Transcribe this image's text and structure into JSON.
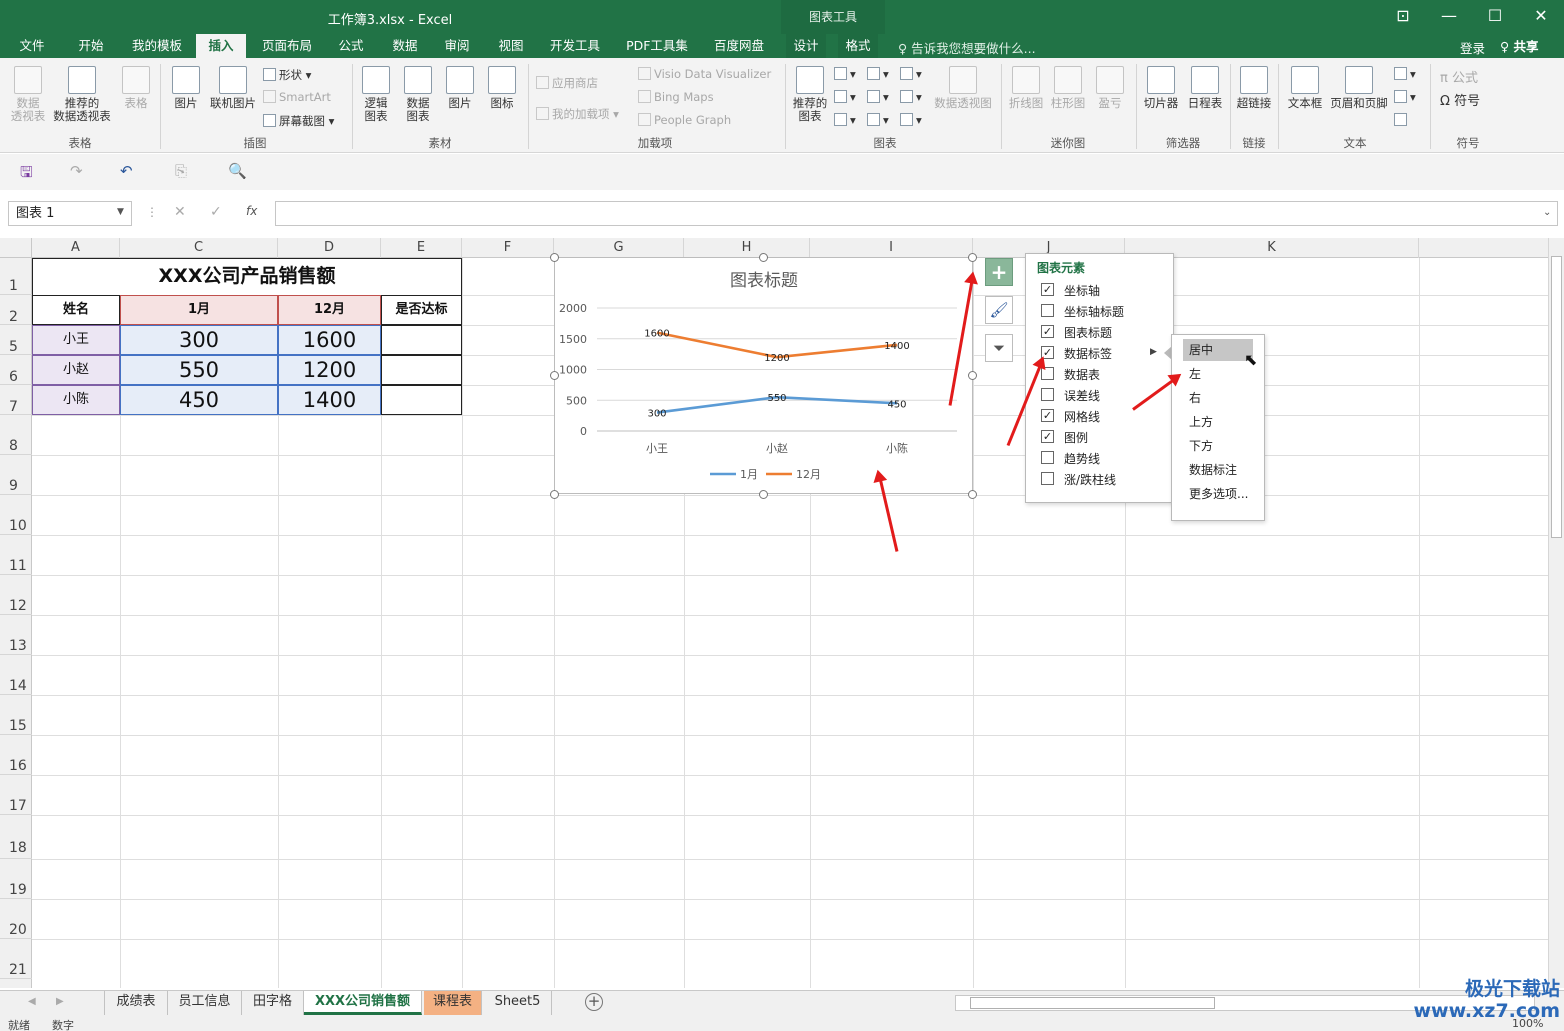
{
  "window": {
    "title": "工作簿3.xlsx - Excel",
    "context_group": "图表工具",
    "buttons": {
      "restore": "⊡",
      "minimize": "—",
      "maximize": "☐",
      "close": "✕"
    }
  },
  "tabs": [
    "文件",
    "开始",
    "我的模板",
    "插入",
    "页面布局",
    "公式",
    "数据",
    "审阅",
    "视图",
    "开发工具",
    "PDF工具集",
    "百度网盘",
    "设计",
    "格式"
  ],
  "active_tab": "插入",
  "tell_me": "♀ 告诉我您想要做什么...",
  "login": "登录",
  "share": "♀ 共享",
  "ribbon": {
    "table_group": {
      "label": "表格",
      "pivot": "数据\n透视表",
      "recommended_pivot": "推荐的\n数据透视表",
      "table": "表格"
    },
    "illustrations": {
      "label": "插图",
      "picture": "图片",
      "online_picture": "联机图片",
      "shapes": "形状",
      "smartart": "SmartArt",
      "screenshot": "屏幕截图"
    },
    "material": {
      "label": "素材",
      "logic_chart": "逻辑\n图表",
      "data_chart": "数据\n图表",
      "picture": "图片",
      "icon": "图标"
    },
    "addins": {
      "label": "加载项",
      "store": "应用商店",
      "my_addins": "我的加载项",
      "visio": "Visio Data Visualizer",
      "bing": "Bing Maps",
      "people": "People Graph"
    },
    "charts": {
      "label": "图表",
      "recommended": "推荐的\n图表",
      "pivot_chart": "数据透视图"
    },
    "sparklines": {
      "label": "迷你图",
      "line": "折线图",
      "column": "柱形图",
      "winloss": "盈亏"
    },
    "filters": {
      "label": "筛选器",
      "slicer": "切片器",
      "timeline": "日程表"
    },
    "links": {
      "label": "链接",
      "hyperlink": "超链接"
    },
    "text": {
      "label": "文本",
      "textbox": "文本框",
      "header_footer": "页眉和页脚"
    },
    "symbols": {
      "label": "符号",
      "equation": "π 公式",
      "symbol": "Ω 符号"
    }
  },
  "name_box": "图表 1",
  "fx": "fx",
  "columns": [
    "A",
    "C",
    "D",
    "E",
    "F",
    "G",
    "H",
    "I",
    "J",
    "K"
  ],
  "rows": [
    "1",
    "2",
    "5",
    "6",
    "7",
    "8",
    "9",
    "10",
    "11",
    "12",
    "13",
    "14",
    "15",
    "16",
    "17",
    "18",
    "19",
    "20",
    "21"
  ],
  "table": {
    "title": "XXX公司产品销售额",
    "headers": [
      "姓名",
      "1月",
      "12月",
      "是否达标"
    ],
    "rows": [
      [
        "小王",
        "300",
        "1600",
        ""
      ],
      [
        "小赵",
        "550",
        "1200",
        ""
      ],
      [
        "小陈",
        "450",
        "1400",
        ""
      ]
    ]
  },
  "chart_data": {
    "type": "line",
    "title": "图表标题",
    "categories": [
      "小王",
      "小赵",
      "小陈"
    ],
    "series": [
      {
        "name": "1月",
        "values": [
          300,
          550,
          450
        ],
        "color": "#5b9bd5"
      },
      {
        "name": "12月",
        "values": [
          1600,
          1200,
          1400
        ],
        "color": "#ed7d31"
      }
    ],
    "yticks": [
      "0",
      "500",
      "1000",
      "1500",
      "2000"
    ],
    "ylim": [
      0,
      2000
    ],
    "grid": true,
    "legend": "bottom",
    "data_labels": true
  },
  "chart_elements": {
    "title": "图表元素",
    "items": [
      {
        "label": "坐标轴",
        "checked": true
      },
      {
        "label": "坐标轴标题",
        "checked": false
      },
      {
        "label": "图表标题",
        "checked": true
      },
      {
        "label": "数据标签",
        "checked": true
      },
      {
        "label": "数据表",
        "checked": false
      },
      {
        "label": "误差线",
        "checked": false
      },
      {
        "label": "网格线",
        "checked": true
      },
      {
        "label": "图例",
        "checked": true
      },
      {
        "label": "趋势线",
        "checked": false
      },
      {
        "label": "涨/跌柱线",
        "checked": false
      }
    ]
  },
  "label_position_menu": [
    "居中",
    "左",
    "右",
    "上方",
    "下方",
    "数据标注",
    "更多选项..."
  ],
  "sheets": [
    "成绩表",
    "员工信息",
    "田字格",
    "XXX公司销售额",
    "课程表",
    "Sheet5"
  ],
  "active_sheet": "XXX公司销售额",
  "status": {
    "ready": "就绪",
    "mode": "数字",
    "zoom": "100%"
  },
  "watermark": "极光下载站\nwww.xz7.com"
}
